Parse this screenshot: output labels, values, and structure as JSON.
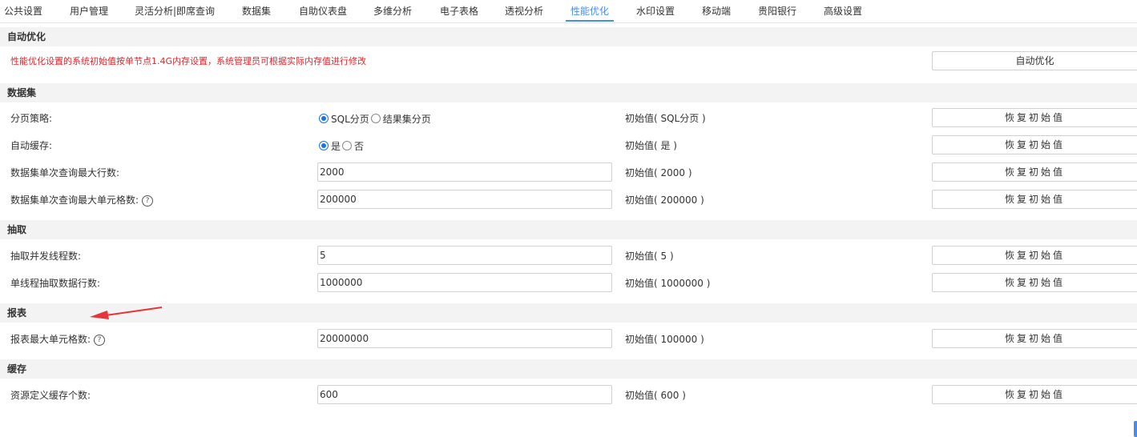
{
  "tabs": [
    {
      "label": "公共设置",
      "active": false
    },
    {
      "label": "用户管理",
      "active": false
    },
    {
      "label": "灵活分析|即席查询",
      "active": false
    },
    {
      "label": "数据集",
      "active": false
    },
    {
      "label": "自助仪表盘",
      "active": false
    },
    {
      "label": "多维分析",
      "active": false
    },
    {
      "label": "电子表格",
      "active": false
    },
    {
      "label": "透视分析",
      "active": false
    },
    {
      "label": "性能优化",
      "active": true
    },
    {
      "label": "水印设置",
      "active": false
    },
    {
      "label": "移动端",
      "active": false
    },
    {
      "label": "贵阳银行",
      "active": false
    },
    {
      "label": "高级设置",
      "active": false
    }
  ],
  "auto_opt": {
    "header": "自动优化",
    "notice": "性能优化设置的系统初始值按单节点1.4G内存设置，系统管理员可根据实际内存值进行修改",
    "button": "自动优化"
  },
  "restore_label": "恢复初始值",
  "help_glyph": "?",
  "dataset": {
    "header": "数据集",
    "paging": {
      "label": "分页策略:",
      "options": [
        "SQL分页",
        "结果集分页"
      ],
      "selected": "SQL分页",
      "default": "初始值( SQL分页 )"
    },
    "cache": {
      "label": "自动缓存:",
      "options": [
        "是",
        "否"
      ],
      "selected": "是",
      "default": "初始值( 是 )"
    },
    "max_rows": {
      "label": "数据集单次查询最大行数:",
      "value": "2000",
      "default": "初始值( 2000 )"
    },
    "max_cells": {
      "label": "数据集单次查询最大单元格数:",
      "value": "200000",
      "default": "初始值( 200000 )"
    }
  },
  "extract": {
    "header": "抽取",
    "threads": {
      "label": "抽取并发线程数:",
      "value": "5",
      "default": "初始值( 5 )"
    },
    "rows_per_thread": {
      "label": "单线程抽取数据行数:",
      "value": "1000000",
      "default": "初始值( 1000000 )"
    }
  },
  "report": {
    "header": "报表",
    "max_cells": {
      "label": "报表最大单元格数:",
      "value": "20000000",
      "default": "初始值( 100000 )"
    }
  },
  "cache_section": {
    "header": "缓存",
    "resource_cache": {
      "label": "资源定义缓存个数:",
      "value": "600",
      "default": "初始值( 600 )"
    }
  },
  "colors": {
    "accent": "#4b8be8",
    "warning": "#e0262c",
    "annotation_arrow": "#e8333a"
  }
}
